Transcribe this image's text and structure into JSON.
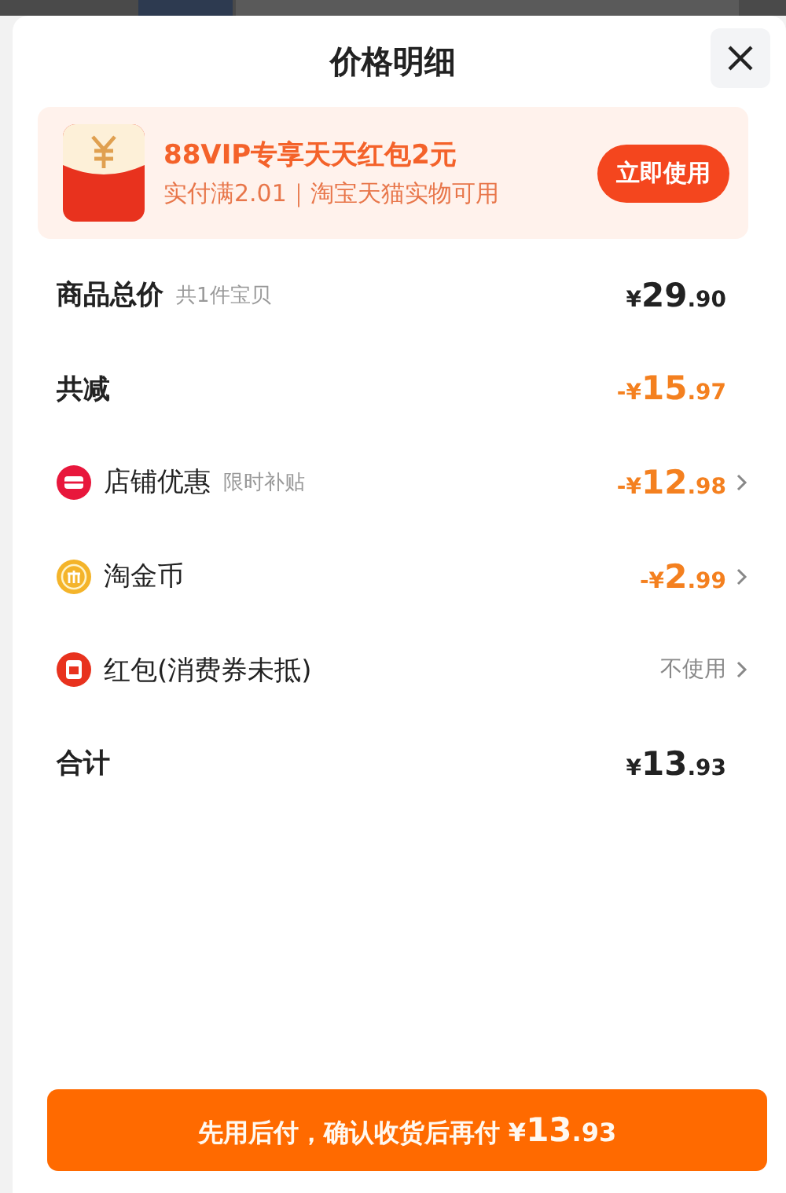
{
  "title": "价格明细",
  "banner": {
    "headline": "88VIP专享天天红包2元",
    "detail": "实付满2.01｜淘宝天猫实物可用",
    "button": "立即使用"
  },
  "rows": [
    {
      "kind": "plain",
      "label": "商品总价",
      "note": "共1件宝贝",
      "color": "#222222",
      "prefix": "¥",
      "int": "29",
      "dec": ".90",
      "chevron": false
    },
    {
      "kind": "plain",
      "label": "共减",
      "color": "#f4801f",
      "prefix": "-¥",
      "int": "15",
      "dec": ".97",
      "chevron": false
    },
    {
      "kind": "shop",
      "label": "店铺优惠",
      "note": "限时补贴",
      "color": "#f4801f",
      "prefix": "-¥",
      "int": "12",
      "dec": ".98",
      "chevron": true
    },
    {
      "kind": "coin",
      "label": "淘金币",
      "color": "#f4801f",
      "prefix": "-¥",
      "int": "2",
      "dec": ".99",
      "chevron": true
    },
    {
      "kind": "redpacket",
      "label": "红包(消费券未抵)",
      "color": "#888888",
      "text": "不使用",
      "chevron": true
    },
    {
      "kind": "plain",
      "label": "合计",
      "color": "#222222",
      "prefix": "¥",
      "int": "13",
      "dec": ".93",
      "chevron": false
    }
  ],
  "pay_button": {
    "label": "先用后付，确认收货后再付",
    "prefix": "¥",
    "int": "13",
    "dec": ".93"
  }
}
